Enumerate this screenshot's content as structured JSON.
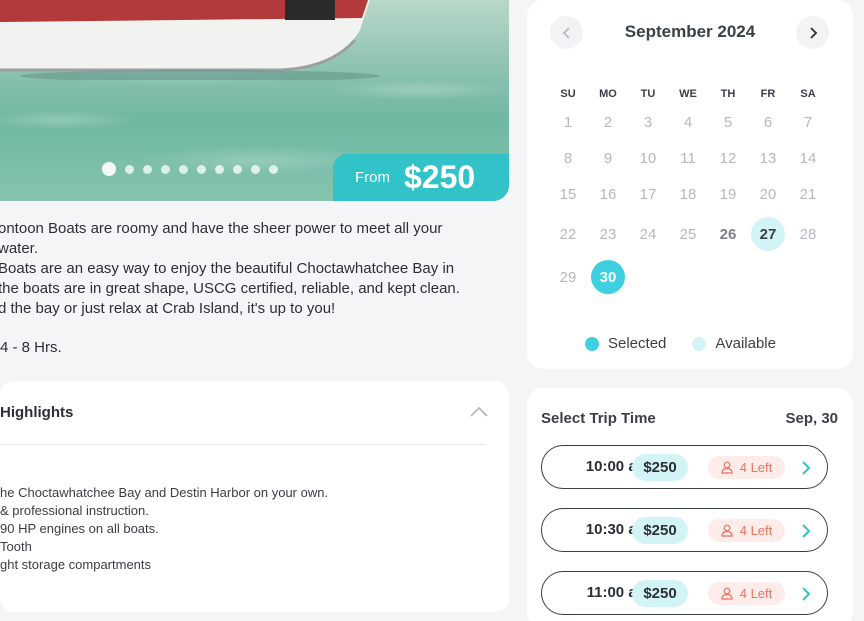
{
  "hero": {
    "price_from_label": "From",
    "price": "$250",
    "slide_count": 10,
    "active_slide": 1
  },
  "description": {
    "lines": [
      "ontoon Boats are roomy and have the sheer power to meet all your",
      "water.",
      "Boats are an easy way to enjoy the beautiful Choctawhatchee Bay in",
      "the boats are in great shape, USCG certified, reliable, and kept clean.",
      "d the bay or just relax at Crab Island, it's up to you!"
    ],
    "duration": "4 - 8 Hrs."
  },
  "highlights": {
    "title": "Highlights",
    "items": [
      "he Choctawhatchee Bay and Destin Harbor on your own.",
      "& professional instruction.",
      "90 HP engines on all boats.",
      "Tooth",
      "ght storage compartments"
    ]
  },
  "calendar": {
    "month_label": "September 2024",
    "weekdays": [
      "SU",
      "MO",
      "TU",
      "WE",
      "TH",
      "FR",
      "SA"
    ],
    "weeks": [
      [
        {
          "d": "1",
          "s": ""
        },
        {
          "d": "2",
          "s": ""
        },
        {
          "d": "3",
          "s": ""
        },
        {
          "d": "4",
          "s": ""
        },
        {
          "d": "5",
          "s": ""
        },
        {
          "d": "6",
          "s": ""
        },
        {
          "d": "7",
          "s": ""
        }
      ],
      [
        {
          "d": "8",
          "s": ""
        },
        {
          "d": "9",
          "s": ""
        },
        {
          "d": "10",
          "s": ""
        },
        {
          "d": "11",
          "s": ""
        },
        {
          "d": "12",
          "s": ""
        },
        {
          "d": "13",
          "s": ""
        },
        {
          "d": "14",
          "s": ""
        }
      ],
      [
        {
          "d": "15",
          "s": ""
        },
        {
          "d": "16",
          "s": ""
        },
        {
          "d": "17",
          "s": ""
        },
        {
          "d": "18",
          "s": ""
        },
        {
          "d": "19",
          "s": ""
        },
        {
          "d": "20",
          "s": ""
        },
        {
          "d": "21",
          "s": ""
        }
      ],
      [
        {
          "d": "22",
          "s": ""
        },
        {
          "d": "23",
          "s": ""
        },
        {
          "d": "24",
          "s": ""
        },
        {
          "d": "25",
          "s": ""
        },
        {
          "d": "26",
          "s": "bold"
        },
        {
          "d": "27",
          "s": "avail"
        },
        {
          "d": "28",
          "s": ""
        }
      ],
      [
        {
          "d": "29",
          "s": ""
        },
        {
          "d": "30",
          "s": "sel"
        }
      ]
    ],
    "legend": [
      {
        "label": "Selected",
        "color": "#3ecfe0"
      },
      {
        "label": "Available",
        "color": "#d2f4f6"
      }
    ]
  },
  "trip_times": {
    "title": "Select Trip Time",
    "date": "Sep, 30",
    "slots": [
      {
        "time": "10:00 am",
        "price": "$250",
        "left": "4 Left"
      },
      {
        "time": "10:30 am",
        "price": "$250",
        "left": "4 Left"
      },
      {
        "time": "11:00 am",
        "price": "$250",
        "left": "4 Left"
      }
    ]
  },
  "colors": {
    "accent": "#32c3c8",
    "selected": "#3ecfe0",
    "available": "#d2f4f6",
    "left_badge_text": "#e8735e"
  }
}
